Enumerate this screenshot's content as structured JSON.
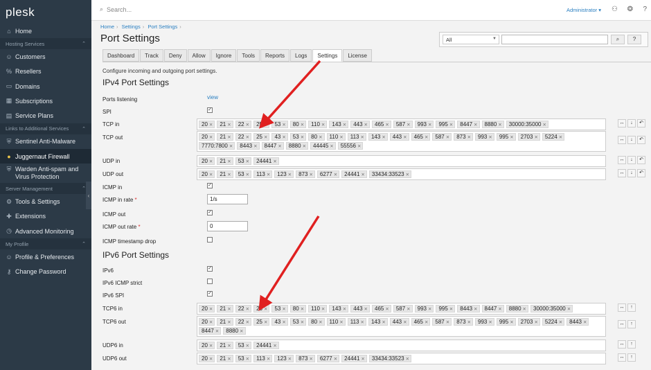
{
  "app": {
    "logo": "plesk"
  },
  "topbar": {
    "search_placeholder": "Search...",
    "user": "Administrator ▾"
  },
  "sidebar": {
    "home": "Home",
    "groups": [
      {
        "title": "Hosting Services",
        "items": [
          "Customers",
          "Resellers",
          "Domains",
          "Subscriptions",
          "Service Plans"
        ]
      },
      {
        "title": "Links to Additional Services",
        "items": [
          "Sentinel Anti-Malware",
          "Juggernaut Firewall",
          "Warden Anti-spam and Virus Protection"
        ]
      },
      {
        "title": "Server Management",
        "items": [
          "Tools & Settings",
          "Extensions",
          "Advanced Monitoring"
        ]
      },
      {
        "title": "My Profile",
        "items": [
          "Profile & Preferences",
          "Change Password"
        ]
      }
    ]
  },
  "breadcrumb": [
    "Home",
    "Settings",
    "Port Settings"
  ],
  "page_title": "Port Settings",
  "filter": {
    "select_value": "All",
    "search_btn": "⌕",
    "help_btn": "?"
  },
  "tabs": [
    "Dashboard",
    "Track",
    "Deny",
    "Allow",
    "Ignore",
    "Tools",
    "Reports",
    "Logs",
    "Settings",
    "License"
  ],
  "active_tab": "Settings",
  "intro": "Configure incoming and outgoing port settings.",
  "ipv4": {
    "title": "IPv4 Port Settings",
    "ports_listening_label": "Ports listening",
    "ports_listening_link": "view",
    "spi_label": "SPI",
    "tcp_in_label": "TCP in",
    "tcp_in": [
      "20",
      "21",
      "22",
      "25",
      "53",
      "80",
      "110",
      "143",
      "443",
      "465",
      "587",
      "993",
      "995",
      "8447",
      "8880",
      "30000:35000"
    ],
    "tcp_out_label": "TCP out",
    "tcp_out": [
      "20",
      "21",
      "22",
      "25",
      "43",
      "53",
      "80",
      "110",
      "113",
      "143",
      "443",
      "465",
      "587",
      "873",
      "993",
      "995",
      "2703",
      "5224",
      "7770:7800",
      "8443",
      "8447",
      "8880",
      "44445",
      "55556"
    ],
    "udp_in_label": "UDP in",
    "udp_in": [
      "20",
      "21",
      "53",
      "24441"
    ],
    "udp_out_label": "UDP out",
    "udp_out": [
      "20",
      "21",
      "53",
      "113",
      "123",
      "873",
      "6277",
      "24441",
      "33434:33523"
    ],
    "icmp_in_label": "ICMP in",
    "icmp_in_rate_label": "ICMP in rate",
    "icmp_in_rate": "1/s",
    "icmp_out_label": "ICMP out",
    "icmp_out_rate_label": "ICMP out rate",
    "icmp_out_rate": "0",
    "icmp_ts_label": "ICMP timestamp drop"
  },
  "ipv6": {
    "title": "IPv6 Port Settings",
    "ipv6_label": "IPv6",
    "icmp_strict_label": "IPv6 ICMP strict",
    "spi_label": "IPv6 SPI",
    "tcp6_in_label": "TCP6 in",
    "tcp6_in": [
      "20",
      "21",
      "22",
      "25",
      "53",
      "80",
      "110",
      "143",
      "443",
      "465",
      "587",
      "993",
      "995",
      "8443",
      "8447",
      "8880",
      "30000:35000"
    ],
    "tcp6_out_label": "TCP6 out",
    "tcp6_out": [
      "20",
      "21",
      "22",
      "25",
      "43",
      "53",
      "80",
      "110",
      "113",
      "143",
      "443",
      "465",
      "587",
      "873",
      "993",
      "995",
      "2703",
      "5224",
      "8443",
      "8447",
      "8880"
    ],
    "udp6_in_label": "UDP6 in",
    "udp6_in": [
      "20",
      "21",
      "53",
      "24441"
    ],
    "udp6_out_label": "UDP6 out",
    "udp6_out": [
      "20",
      "21",
      "53",
      "113",
      "123",
      "873",
      "6277",
      "24441",
      "33434:33523"
    ]
  },
  "colors": {
    "sidebar": "#2c3a47",
    "accent": "#2a7fc1",
    "arrow": "#e02020"
  }
}
